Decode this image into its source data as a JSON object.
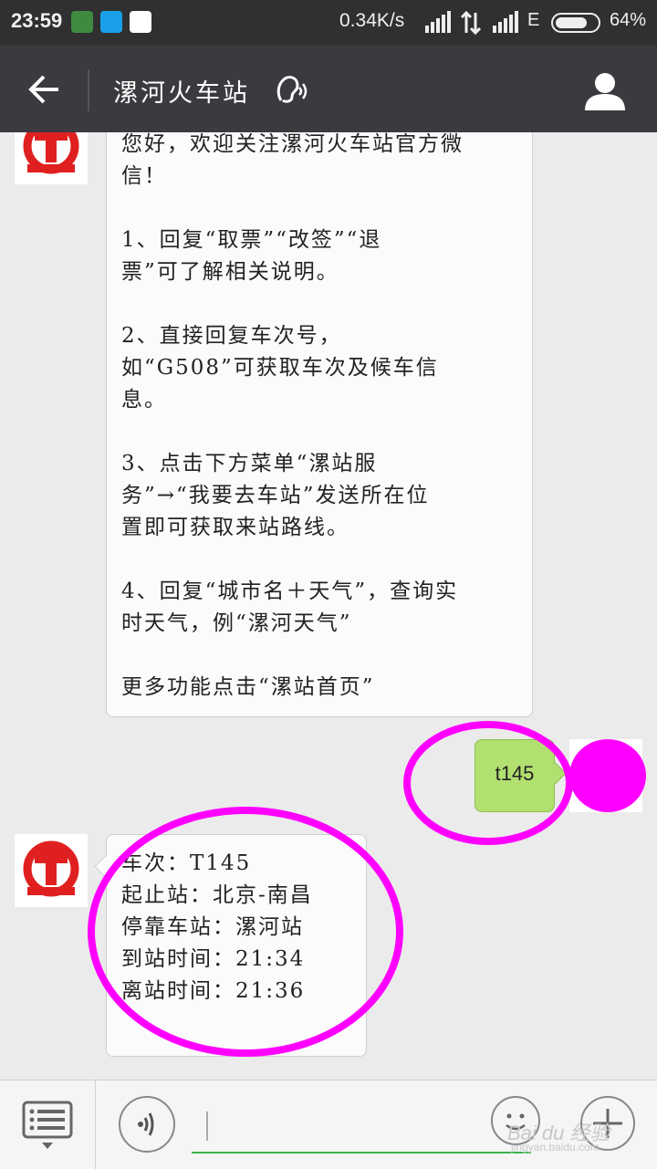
{
  "status_bar": {
    "time": "23:59",
    "net_speed": "0.34K/s",
    "network_type": "E",
    "battery": "64%"
  },
  "header": {
    "title": "漯河火车站",
    "back_icon": "back-arrow-icon",
    "voice_icon": "ear-icon",
    "profile_icon": "profile-icon"
  },
  "messages": {
    "welcome": "您好，欢迎关注漯河火车站官方微\n信！\n\n1、回复“取票”“改签”“退\n票”可了解相关说明。\n\n2、直接回复车次号，\n如“G508”可获取车次及候车信\n息。\n\n3、点击下方菜单“漯站服\n务”→“我要去车站”发送所在位\n置即可获取来站路线。\n\n4、回复“城市名＋天气”，查询实\n时天气，例“漯河天气”\n\n更多功能点击“漯站首页”",
    "sent": "t145",
    "reply_lines": [
      "车次：T145",
      "起止站：北京-南昌",
      "停靠车站：漯河站",
      "到站时间：21:34",
      "离站时间：21:36"
    ]
  },
  "bottom_bar": {
    "watermark": "Bai du 经验",
    "watermark_url": "jingyan.baidu.com"
  },
  "colors": {
    "sent_bubble": "#b2e070",
    "annotation": "#ff00ff",
    "railway_logo": "#e02020"
  }
}
